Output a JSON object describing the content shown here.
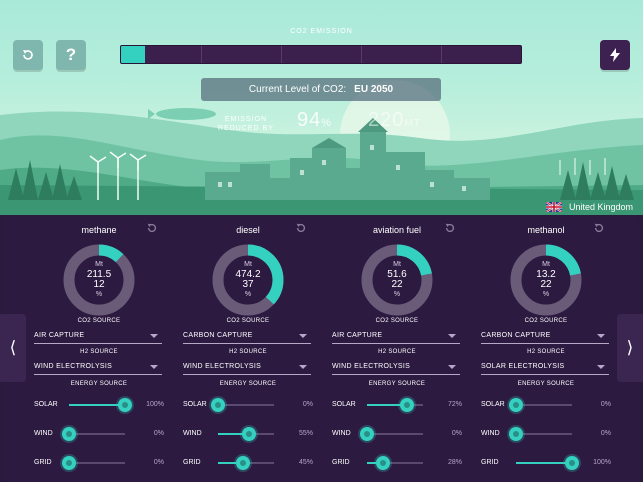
{
  "top_bar": {
    "emission_label": "CO2 EMISSION",
    "emission_progress": 0.06,
    "co2_level_label": "Current Level of CO2:",
    "co2_level_value": "EU 2050",
    "reduced_label_line1": "EMISSION",
    "reduced_label_line2": "REDUCED BY",
    "reduced_percent": "94",
    "reduced_percent_unit": "%",
    "emission_mt": "220",
    "emission_mt_unit": "MT",
    "country": "United Kingdom"
  },
  "labels": {
    "co2_source": "CO2 SOURCE",
    "h2_source": "H2 SOURCE",
    "energy_source": "ENERGY SOURCE",
    "solar": "SOLAR",
    "wind": "WIND",
    "grid": "GRID",
    "mt_unit": "Mt",
    "percent_unit": "%"
  },
  "colors": {
    "accent": "#34d1c1",
    "donut_track": "#6a5b78",
    "panel": "#2c1a40"
  },
  "fuels": [
    {
      "name": "methane",
      "mt": "211.5",
      "percent": "12",
      "share": 0.12,
      "co2_source": "AIR CAPTURE",
      "h2_source": "WIND ELECTROLYSIS",
      "solar": {
        "value": 1.0,
        "label": "100%"
      },
      "wind": {
        "value": 0.0,
        "label": "0%"
      },
      "grid": {
        "value": 0.0,
        "label": "0%"
      }
    },
    {
      "name": "diesel",
      "mt": "474.2",
      "percent": "37",
      "share": 0.37,
      "co2_source": "CARBON CAPTURE",
      "h2_source": "WIND ELECTROLYSIS",
      "solar": {
        "value": 0.0,
        "label": "0%"
      },
      "wind": {
        "value": 0.55,
        "label": "55%"
      },
      "grid": {
        "value": 0.45,
        "label": "45%"
      }
    },
    {
      "name": "aviation fuel",
      "mt": "51.6",
      "percent": "22",
      "share": 0.22,
      "co2_source": "AIR CAPTURE",
      "h2_source": "WIND ELECTROLYSIS",
      "solar": {
        "value": 0.72,
        "label": "72%"
      },
      "wind": {
        "value": 0.0,
        "label": "0%"
      },
      "grid": {
        "value": 0.28,
        "label": "28%"
      }
    },
    {
      "name": "methanol",
      "mt": "13.2",
      "percent": "22",
      "share": 0.22,
      "co2_source": "CARBON CAPTURE",
      "h2_source": "SOLAR ELECTROLYSIS",
      "solar": {
        "value": 0.0,
        "label": "0%"
      },
      "wind": {
        "value": 0.0,
        "label": "0%"
      },
      "grid": {
        "value": 1.0,
        "label": "100%"
      }
    }
  ],
  "icons": {
    "reset": "reset-icon",
    "help": "help-icon",
    "power": "lightning-icon",
    "prev": "chevron-left-icon",
    "next": "chevron-right-icon"
  }
}
